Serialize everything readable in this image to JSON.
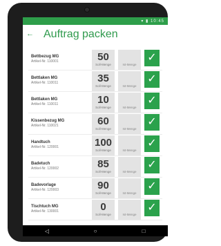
{
  "app": {
    "title": "Auftrag packen",
    "back_icon": "arrow-left-icon",
    "accent": "#2e9e4a"
  },
  "status_bar": {
    "icons": "▾ ▮ 10:45"
  },
  "items": [
    {
      "name": "Bettbezug MG",
      "article": "Artikel-Nr. 110001",
      "soll": "50",
      "soll_label": "Soll-Menge",
      "ist_label": "Ist-Menge"
    },
    {
      "name": "Bettlaken MG",
      "article": "Artikel-Nr. 110011",
      "soll": "35",
      "soll_label": "Soll-Menge",
      "ist_label": "Ist-Menge"
    },
    {
      "name": "Bettlaken MG",
      "article": "Artikel-Nr. 110011",
      "soll": "10",
      "soll_label": "Soll-Menge",
      "ist_label": "Ist-Menge"
    },
    {
      "name": "Kissenbezug MG",
      "article": "Artikel-Nr. 110021",
      "soll": "60",
      "soll_label": "Soll-Menge",
      "ist_label": "Ist-Menge"
    },
    {
      "name": "Handtuch",
      "article": "Artikel-Nr. 120001",
      "soll": "100",
      "soll_label": "Soll-Menge",
      "ist_label": "Ist-Menge"
    },
    {
      "name": "Badetuch",
      "article": "Artikel-Nr. 120002",
      "soll": "85",
      "soll_label": "Soll-Menge",
      "ist_label": "Ist-Menge"
    },
    {
      "name": "Badevorlage",
      "article": "Artikel-Nr. 120003",
      "soll": "90",
      "soll_label": "Soll-Menge",
      "ist_label": "Ist-Menge"
    },
    {
      "name": "Tischtuch MG",
      "article": "Artikel-Nr. 130001",
      "soll": "0",
      "soll_label": "Soll-Menge",
      "ist_label": "Ist-Menge"
    }
  ],
  "check_glyph": "✓",
  "nav": {
    "back": "◁",
    "home": "○",
    "recents": "□"
  }
}
